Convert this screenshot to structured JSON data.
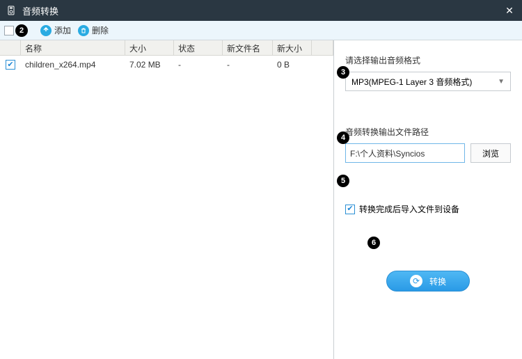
{
  "window": {
    "title": "音频转换"
  },
  "toolbar": {
    "add_label": "添加",
    "delete_label": "删除"
  },
  "table": {
    "headers": {
      "name": "名称",
      "size": "大小",
      "status": "状态",
      "newname": "新文件名",
      "newsize": "新大小"
    },
    "row0": {
      "name": "children_x264.mp4",
      "size": "7.02 MB",
      "status": "-",
      "newname": "-",
      "newsize": "0 B"
    }
  },
  "right": {
    "format_label": "请选择输出音频格式",
    "format_value": "MP3(MPEG-1 Layer 3 音频格式)",
    "path_label": "音频转换输出文件路径",
    "path_value": "F:\\个人资料\\Syncios",
    "browse_label": "浏览",
    "import_label": "转换完成后导入文件到设备",
    "convert_label": "转换"
  },
  "badges": {
    "b2": "2",
    "b3": "3",
    "b4": "4",
    "b5": "5",
    "b6": "6"
  }
}
